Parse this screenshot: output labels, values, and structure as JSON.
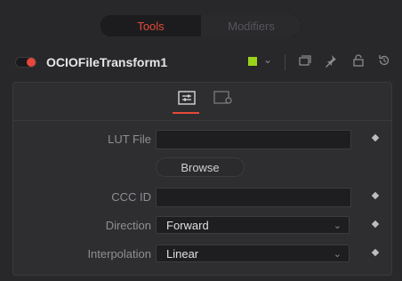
{
  "tabs": {
    "active": "Tools",
    "inactive": "Modifiers"
  },
  "header": {
    "title": "OCIOFileTransform1",
    "color_swatch": "#9ad31a",
    "icons": [
      "chevron-down-icon",
      "window-icon",
      "pin-icon",
      "lock-icon",
      "reset-icon"
    ]
  },
  "panel": {
    "tab_icons": [
      "controls-tab-icon",
      "settings-tab-icon"
    ],
    "rows": {
      "lut_file": {
        "label": "LUT File",
        "value": ""
      },
      "browse": {
        "label": "Browse"
      },
      "ccc_id": {
        "label": "CCC ID",
        "value": ""
      },
      "direction": {
        "label": "Direction",
        "value": "Forward"
      },
      "interpolation": {
        "label": "Interpolation",
        "value": "Linear"
      }
    }
  },
  "colors": {
    "accent": "#e44a3a",
    "enabled_dot": "#e8473b"
  }
}
